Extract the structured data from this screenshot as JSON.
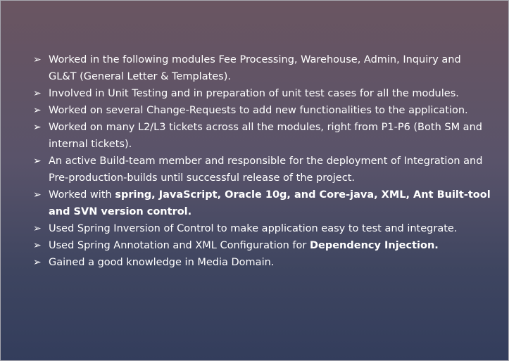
{
  "bullet_glyph": "➢",
  "items": [
    {
      "parts": [
        {
          "text": "Worked in the following modules Fee Processing, Warehouse, Admin, Inquiry and GL&T (General Letter & Templates).",
          "bold": false
        }
      ]
    },
    {
      "parts": [
        {
          "text": "Involved in Unit Testing and in preparation of unit test cases for all the modules.",
          "bold": false
        }
      ]
    },
    {
      "parts": [
        {
          "text": "Worked on several Change-Requests to add new functionalities to the application.",
          "bold": false
        }
      ]
    },
    {
      "parts": [
        {
          "text": "Worked on many L2/L3 tickets across all the modules, right from P1-P6 (Both SM and internal tickets).",
          "bold": false
        }
      ]
    },
    {
      "parts": [
        {
          "text": "An active Build-team member and responsible for the deployment of Integration and Pre-production-builds until successful release of the project.",
          "bold": false
        }
      ]
    },
    {
      "parts": [
        {
          "text": "Worked with ",
          "bold": false
        },
        {
          "text": "spring, JavaScript, Oracle 10g, and Core-java, XML, Ant Built-tool and SVN version control.",
          "bold": true
        }
      ]
    },
    {
      "parts": [
        {
          "text": "Used Spring Inversion of Control to make application easy to test and integrate.",
          "bold": false
        }
      ]
    },
    {
      "parts": [
        {
          "text": "Used Spring Annotation and XML Configuration for ",
          "bold": false
        },
        {
          "text": "Dependency Injection.",
          "bold": true
        }
      ]
    },
    {
      "parts": [
        {
          "text": "Gained a good knowledge in Media Domain.",
          "bold": false
        }
      ]
    }
  ]
}
